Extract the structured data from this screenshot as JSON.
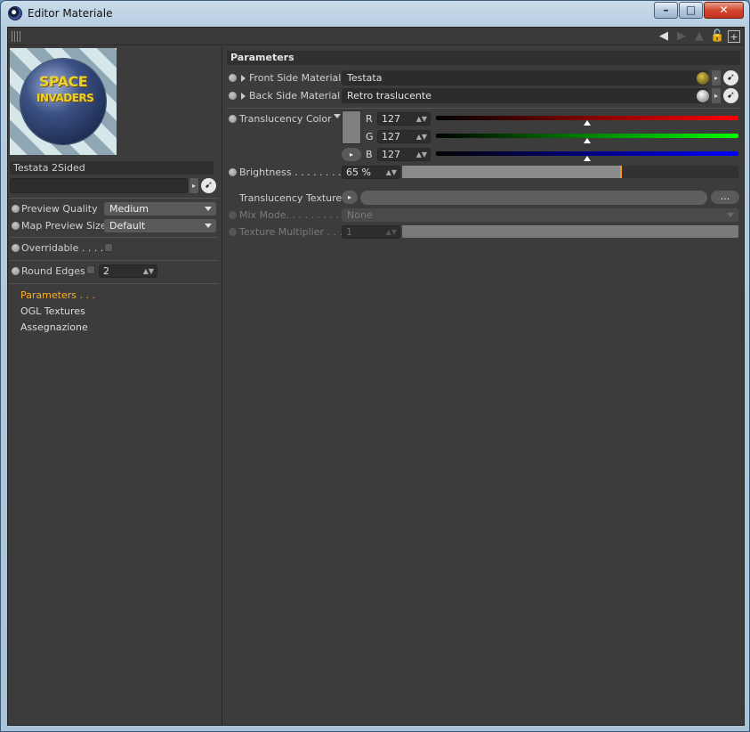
{
  "window": {
    "title": "Editor Materiale"
  },
  "preview": {
    "text_line1": "SPACE",
    "text_line2": "INVADERS"
  },
  "left": {
    "material_name": "Testata 2Sided",
    "preview_quality": {
      "label": "Preview Quality",
      "value": "Medium"
    },
    "map_preview_size": {
      "label": "Map Preview Size",
      "value": "Default"
    },
    "overridable": {
      "label": "Overridable . . . ."
    },
    "round_edges": {
      "label": "Round Edges",
      "value": "2"
    },
    "nav": [
      "Parameters . . .",
      "OGL Textures",
      "Assegnazione"
    ]
  },
  "right": {
    "header": "Parameters",
    "front": {
      "label": "Front Side Material",
      "value": "Testata"
    },
    "back": {
      "label": "Back Side Material",
      "value": "Retro traslucente"
    },
    "translucency_color": {
      "label": "Translucency Color",
      "r": {
        "label": "R",
        "value": "127",
        "fraction": 0.5
      },
      "g": {
        "label": "G",
        "value": "127",
        "fraction": 0.5
      },
      "b": {
        "label": "B",
        "value": "127",
        "fraction": 0.5
      }
    },
    "brightness": {
      "label": "Brightness . . . . . . . . .",
      "value": "65 %",
      "percent": 65
    },
    "translucency_texture": {
      "label": "Translucency Texture",
      "more": "..."
    },
    "mix_mode": {
      "label": "Mix Mode. . . . . . . . . . .",
      "value": "None"
    },
    "texture_multiplier": {
      "label": "Texture Multiplier . . .",
      "value": "1"
    }
  }
}
